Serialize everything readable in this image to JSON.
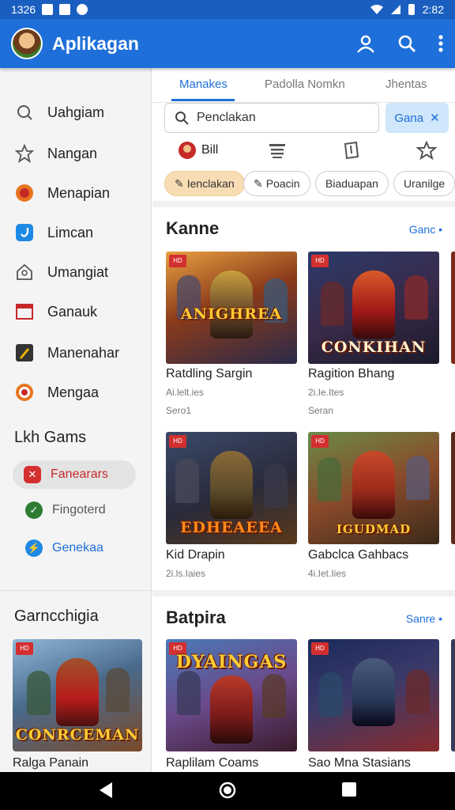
{
  "status_bar": {
    "time": "1326",
    "right_time": "2:82"
  },
  "app_bar": {
    "title": "Aplikagan"
  },
  "sidebar": {
    "items": [
      {
        "label": "Uahgiam",
        "icon": "search-icon"
      },
      {
        "label": "Nangan",
        "icon": "star-outline-icon"
      },
      {
        "label": "Menapian",
        "icon": "orange-badge-icon"
      },
      {
        "label": "Limcan",
        "icon": "blue-app-icon"
      },
      {
        "label": "Umangiat",
        "icon": "home-outline-icon"
      },
      {
        "label": "Ganauk",
        "icon": "red-window-icon"
      },
      {
        "label": "Manenahar",
        "icon": "pencil-box-icon"
      },
      {
        "label": "Mengaa",
        "icon": "orange-target-icon"
      }
    ],
    "games_heading": "Lkh Gams",
    "sub_items": [
      {
        "label": "Fanearars",
        "icon": "red-x-icon",
        "color": "#d32f2f"
      },
      {
        "label": "Fingoterd",
        "icon": "green-check-icon",
        "color": "#2e7d32"
      },
      {
        "label": "Genekaa",
        "icon": "blue-messenger-icon",
        "color": "#1e6fd9"
      }
    ],
    "section_title": "Garncchigia",
    "card": {
      "title": "Ralga Panain",
      "art_text": "CONRCEMAN"
    }
  },
  "main": {
    "tabs": [
      "Manakes",
      "Padolla Nomkn",
      "Jhentas"
    ],
    "search": {
      "placeholder": "Penclakan",
      "button": "Gana"
    },
    "icon_row": [
      {
        "label": "Bill",
        "icon": "avatar-icon"
      },
      {
        "label": "",
        "icon": "list-icon"
      },
      {
        "label": "",
        "icon": "book-icon"
      },
      {
        "label": "",
        "icon": "star-share-icon"
      }
    ],
    "filters": [
      "Ienclakan",
      "Poacin",
      "Biaduapan",
      "Uranilge"
    ],
    "section1": {
      "title": "Kanne",
      "see_all": "Ganc •",
      "cards": [
        {
          "title": "Ratdling Sargin",
          "meta": "Ai.lelt.ies",
          "meta2": "Sero1",
          "art_text": "ANIGHREA"
        },
        {
          "title": "Ragition Bhang",
          "meta": "2i.Ie.Ites",
          "meta2": "Seran",
          "art_text": "CONKIHAN"
        },
        {
          "title": "Kid Drapin",
          "meta": "2i.ls.Iaies",
          "meta2": "",
          "art_text": "EDHEAEEA"
        },
        {
          "title": "Gabclca Gahbacs",
          "meta": "4i.Iet.Iies",
          "meta2": "",
          "art_text": "IGUDMAD"
        }
      ]
    },
    "section2": {
      "title": "Batpira",
      "see_all": "Sanre •",
      "cards": [
        {
          "title": "Raplilam Coams",
          "art_text": "DYAINGAS"
        },
        {
          "title": "Sao Mna Stasians",
          "art_text": ""
        }
      ]
    }
  },
  "colors": {
    "primary": "#1e6fd9",
    "status_bar": "#1a5fc0",
    "chip_active": "#f8ddb4"
  }
}
